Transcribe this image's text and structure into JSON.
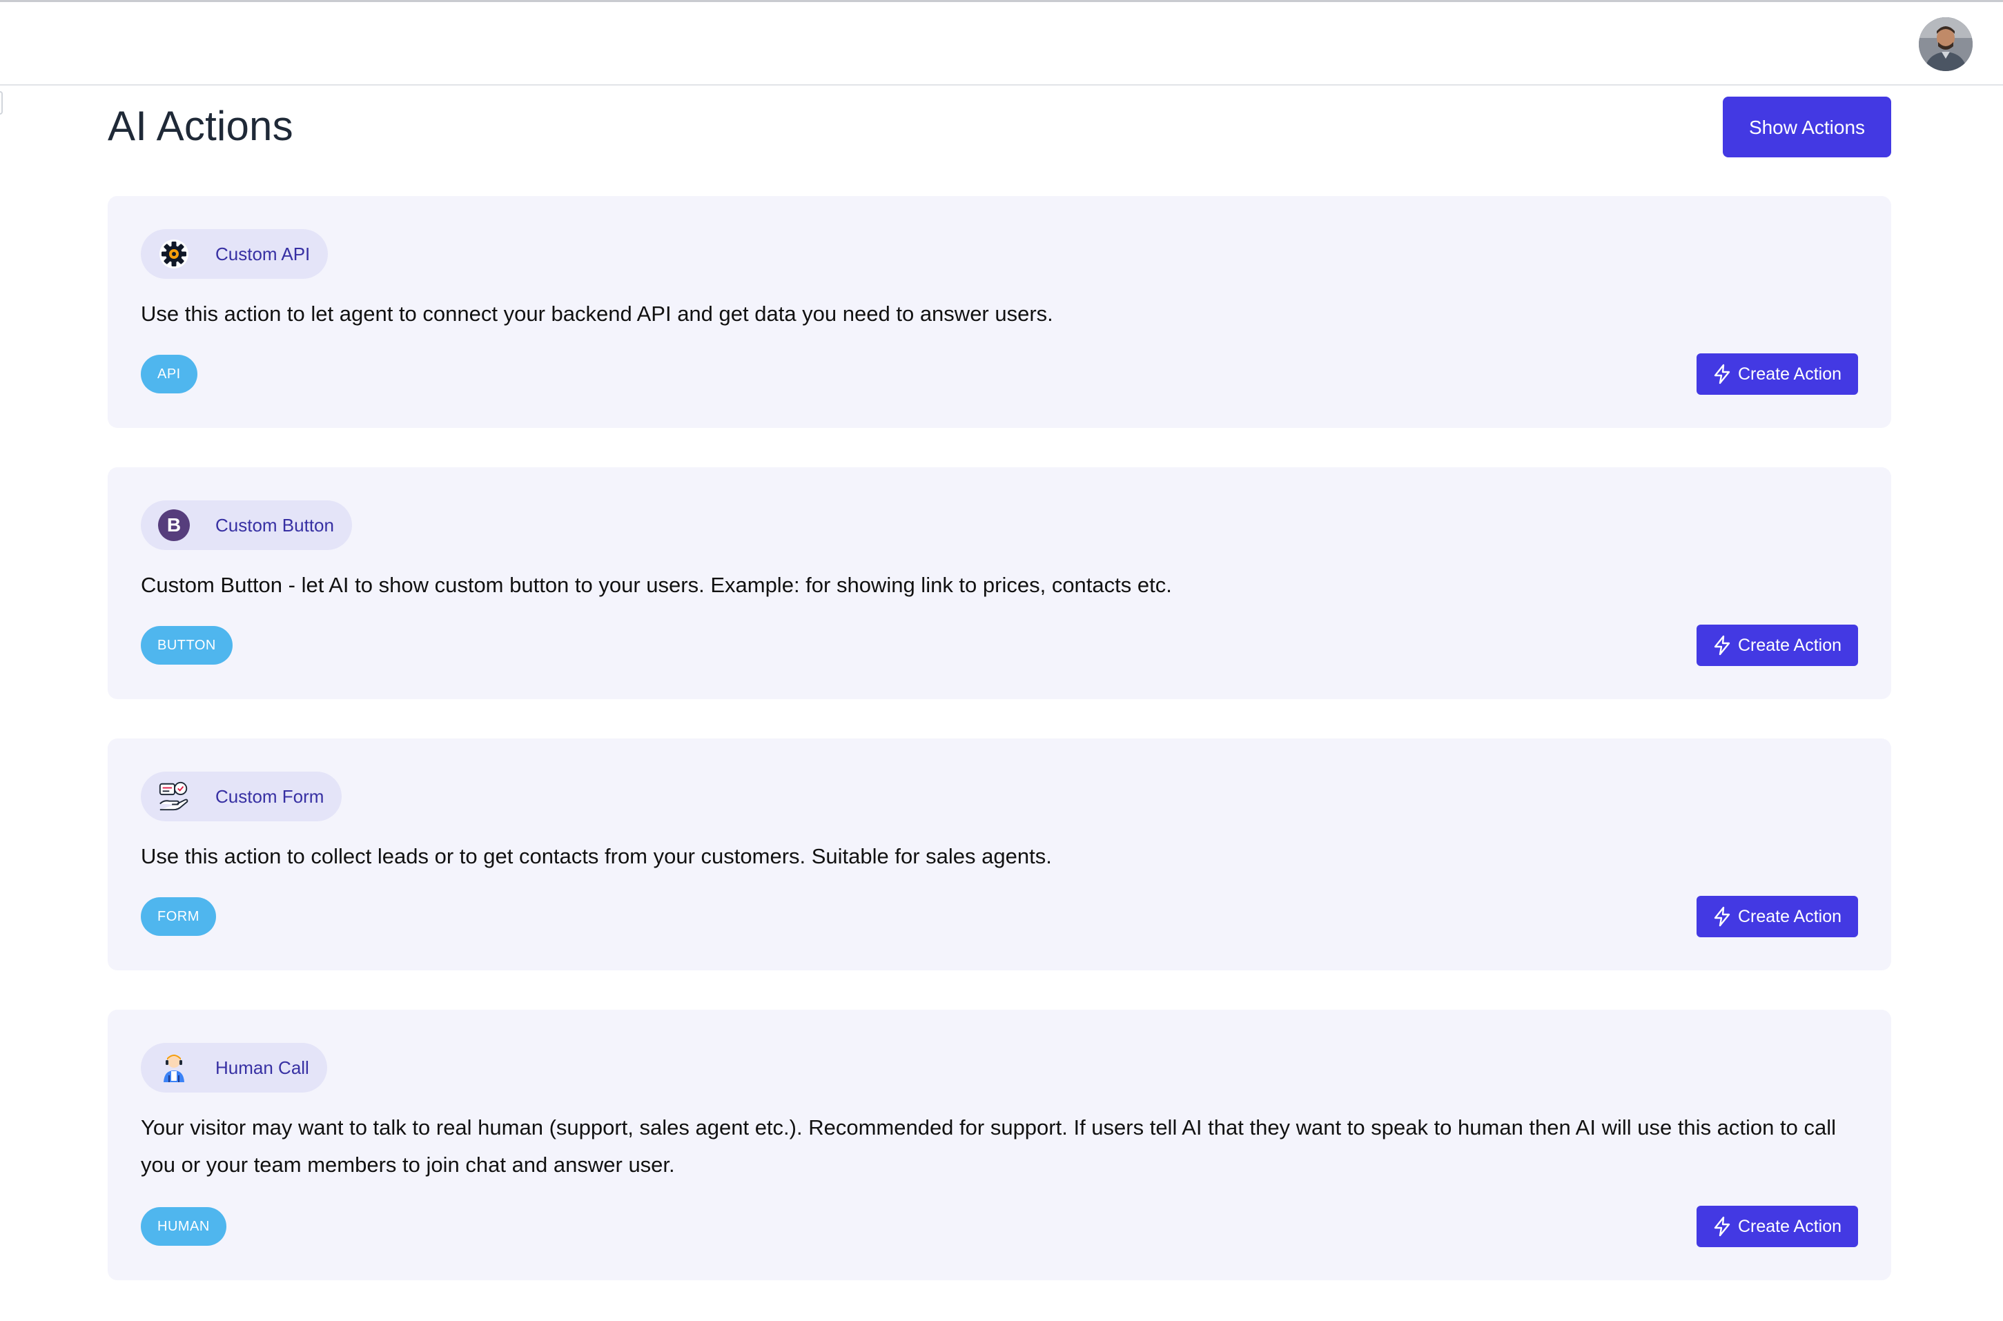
{
  "page": {
    "title": "AI Actions",
    "show_actions_label": "Show Actions"
  },
  "header": {
    "avatar_alt": "user avatar"
  },
  "actions": [
    {
      "name": "Custom API",
      "icon": "gear-icon",
      "description": "Use this action to let agent to connect your backend API and get data you need to answer users.",
      "tag": "API",
      "button_label": "Create Action"
    },
    {
      "name": "Custom Button",
      "icon": "bootstrap-b-icon",
      "description": "Custom Button - let AI to show custom button to your users. Example: for showing link to prices, contacts etc.",
      "tag": "BUTTON",
      "button_label": "Create Action"
    },
    {
      "name": "Custom Form",
      "icon": "hand-with-form-icon",
      "description": "Use this action to collect leads or to get contacts from your customers. Suitable for sales agents.",
      "tag": "FORM",
      "button_label": "Create Action"
    },
    {
      "name": "Human Call",
      "icon": "support-person-icon",
      "description": "Your visitor may want to talk to real human (support, sales agent etc.). Recommended for support. If users tell AI that they want to speak to human then AI will use this action to call you or your team members to join chat and answer user.",
      "tag": "HUMAN",
      "button_label": "Create Action"
    }
  ],
  "colors": {
    "primary": "#4339e3",
    "card_bg": "#f4f4fc",
    "chip_bg": "#e4e4f8",
    "chip_text": "#3730a3",
    "tag_bg": "#4fb6ee"
  }
}
